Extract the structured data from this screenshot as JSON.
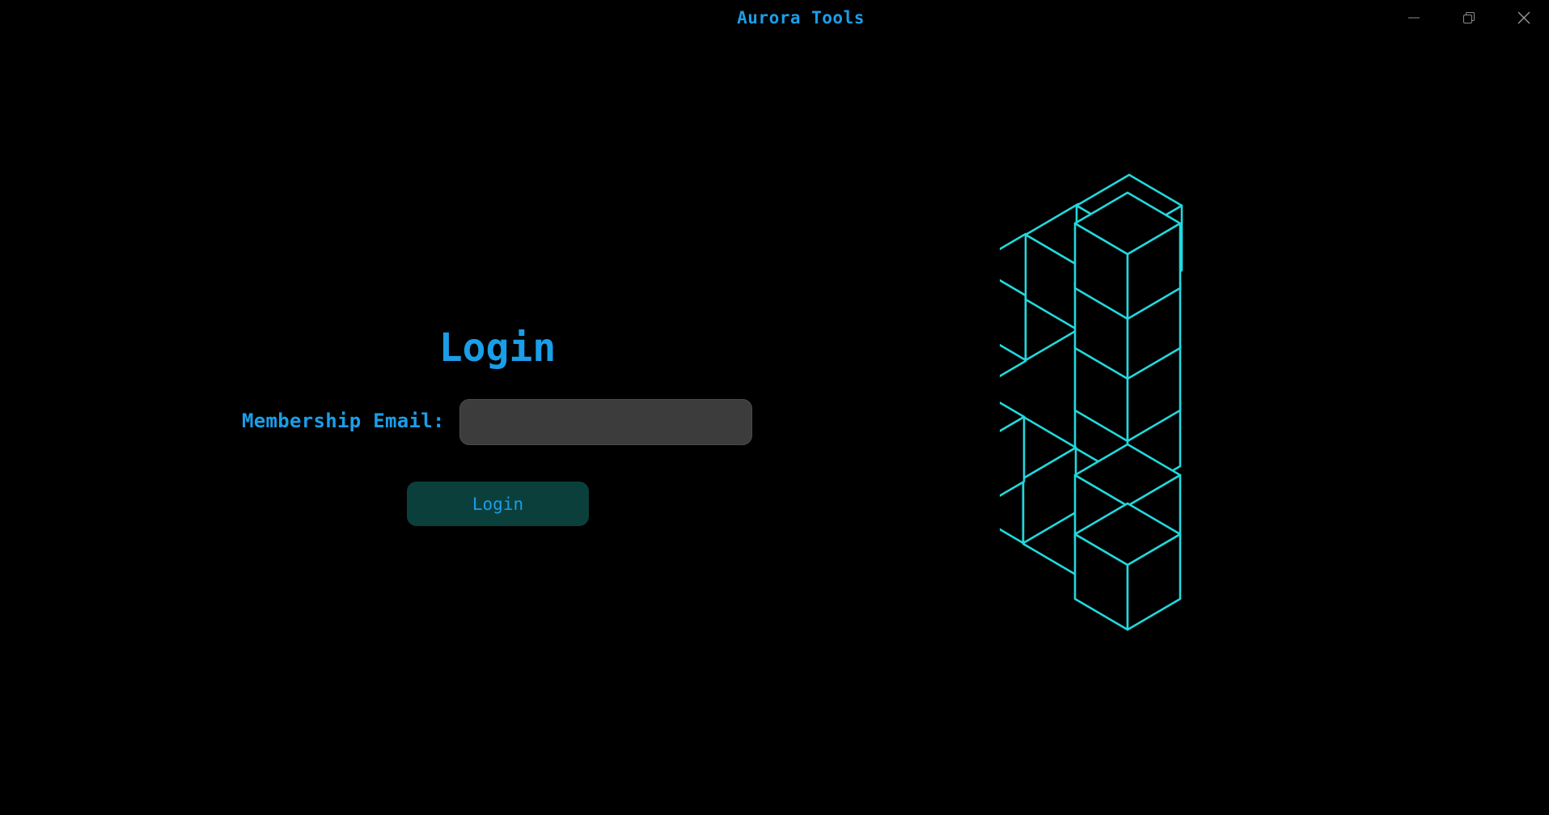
{
  "window": {
    "title": "Aurora Tools",
    "controls": {
      "minimize_icon": "minimize-icon",
      "maximize_icon": "restore-icon",
      "close_icon": "close-icon"
    }
  },
  "login": {
    "heading": "Login",
    "email_label": "Membership Email:",
    "email_value": "",
    "email_placeholder": "",
    "button_label": "Login"
  },
  "illustration": {
    "icon": "impossible-triangle-cubes-icon"
  },
  "colors": {
    "background": "#000000",
    "accent_text": "#1a9ee8",
    "input_background": "#3c3c3c",
    "button_background": "#0b3f3c",
    "illustration_stroke": "#22d8dc"
  }
}
